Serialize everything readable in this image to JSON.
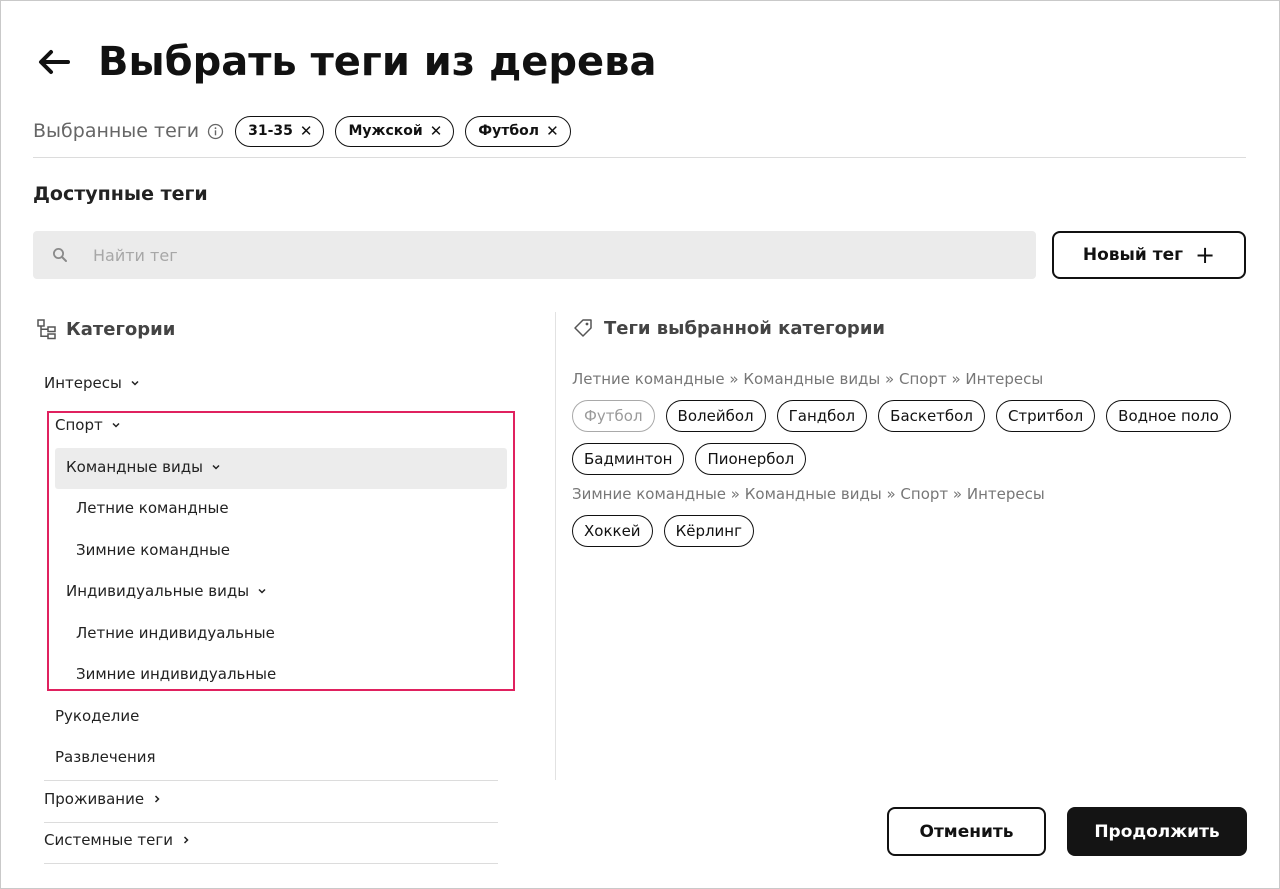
{
  "header": {
    "title": "Выбрать теги из дерева"
  },
  "selected": {
    "label": "Выбранные теги",
    "chips": [
      "31-35",
      "Мужской",
      "Футбол"
    ]
  },
  "available": {
    "title": "Доступные теги"
  },
  "search": {
    "placeholder": "Найти тег",
    "value": ""
  },
  "new_tag": {
    "label": "Новый тег"
  },
  "categories": {
    "title": "Категории",
    "items": [
      "Интересы",
      "Спорт",
      "Командные виды",
      "Летние командные",
      "Зимние командные",
      "Индивидуальные виды",
      "Летние индивидуальные",
      "Зимние индивидуальные",
      "Рукоделие",
      "Развлечения",
      "Проживание",
      "Системные теги"
    ]
  },
  "category_tags": {
    "title": "Теги выбранной категории",
    "groups": [
      {
        "path": "Летние командные » Командные виды » Спорт » Интересы",
        "tags": [
          "Футбол",
          "Волейбол",
          "Гандбол",
          "Баскетбол",
          "Стритбол",
          "Водное поло",
          "Бадминтон",
          "Пионербол"
        ]
      },
      {
        "path": "Зимние командные » Командные виды » Спорт » Интересы",
        "tags": [
          "Хоккей",
          "Кёрлинг"
        ]
      }
    ]
  },
  "footer": {
    "cancel": "Отменить",
    "continue": "Продолжить"
  },
  "colors": {
    "accent_highlight": "#e0215f",
    "primary_button": "#141414",
    "search_bg": "#ebebeb"
  }
}
